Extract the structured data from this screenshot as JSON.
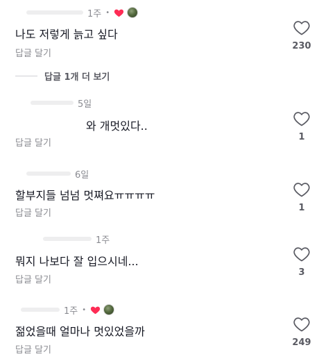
{
  "colors": {
    "heart_red": "#fe2c55",
    "text": "#161823",
    "muted": "#8a8b91"
  },
  "comments": [
    {
      "time": "1주",
      "dot": "•",
      "creator_liked": true,
      "text": "나도 저렇게 늙고 싶다",
      "reply_label": "답글 달기",
      "likes": "230"
    },
    {
      "time": "5일",
      "text": "와 개멋있다..",
      "reply_label": "답글 달기",
      "likes": "1"
    },
    {
      "time": "6일",
      "text": "할부지들 넘넘 멋쪄요ㅠㅠㅠㅠ",
      "reply_label": "답글 달기",
      "likes": "1"
    },
    {
      "time": "1주",
      "text": "뭐지 나보다 잘 입으시네...",
      "reply_label": "답글 달기",
      "likes": "3"
    },
    {
      "time": "1주",
      "dot": "•",
      "creator_liked": true,
      "text": "젊었을때 얼마나 멋있었을까",
      "reply_label": "답글 달기",
      "likes": "249"
    }
  ],
  "view_more_replies": "답글 1개 더 보기",
  "icons": {
    "like": "heart-outline-icon",
    "creator_like": "heart-filled-icon"
  }
}
